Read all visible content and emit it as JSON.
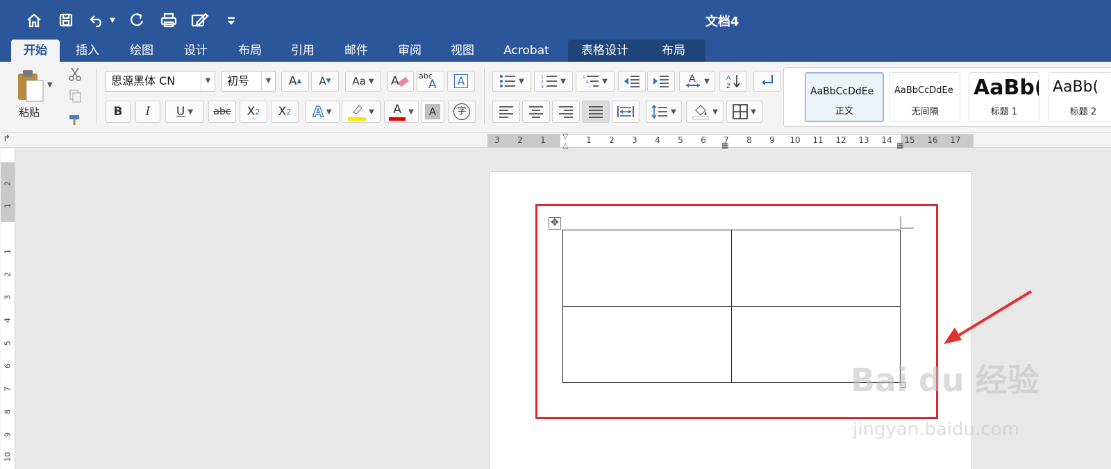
{
  "app": {
    "document_title": "文档4",
    "accent_color": "#2b579a"
  },
  "quick_access": [
    {
      "name": "home-icon"
    },
    {
      "name": "save-icon"
    },
    {
      "name": "undo-icon"
    },
    {
      "name": "redo-icon"
    },
    {
      "name": "print-icon"
    },
    {
      "name": "edit-doc-icon"
    },
    {
      "name": "customize-toolbar-icon"
    }
  ],
  "tabs": [
    {
      "label": "开始",
      "active": true
    },
    {
      "label": "插入"
    },
    {
      "label": "绘图"
    },
    {
      "label": "设计"
    },
    {
      "label": "布局"
    },
    {
      "label": "引用"
    },
    {
      "label": "邮件"
    },
    {
      "label": "审阅"
    },
    {
      "label": "视图"
    },
    {
      "label": "Acrobat"
    },
    {
      "label": "表格设计",
      "contextual": true
    },
    {
      "label": "布局",
      "contextual": true
    }
  ],
  "clipboard": {
    "paste_label": "粘贴"
  },
  "font": {
    "family": "思源黑体 CN",
    "size": "初号",
    "bold": "B",
    "italic": "I",
    "underline": "U",
    "strikethrough": "abc",
    "subscript": "X",
    "subscript_mark": "2",
    "superscript": "X",
    "superscript_mark": "2",
    "grow": "A",
    "shrink": "A",
    "change_case": "Aa",
    "phonetic": "abc",
    "font_color_glyph": "A",
    "shading_glyph": "A",
    "enclose_glyph": "字",
    "highlight_color": "#f5e600",
    "font_color": "#e00000"
  },
  "styles": [
    {
      "sample": "AaBbCcDdEe",
      "name": "正文",
      "selected": true
    },
    {
      "sample": "AaBbCcDdEe",
      "name": "无间隔"
    },
    {
      "sample": "AaBb(",
      "name": "标题 1"
    },
    {
      "sample": "AaBb(",
      "name": "标题 2"
    }
  ],
  "ruler": {
    "left_labels": [
      "3",
      "2",
      "1"
    ],
    "right_labels": [
      "1",
      "2",
      "3",
      "4",
      "5",
      "6",
      "7",
      "8",
      "9",
      "10",
      "11",
      "12",
      "13",
      "14",
      "15",
      "16",
      "17"
    ],
    "vertical_labels": [
      "2",
      "1",
      "1",
      "2",
      "3",
      "4",
      "5",
      "6",
      "7",
      "8",
      "9",
      "10"
    ]
  },
  "document": {
    "table": {
      "rows": 2,
      "cols": 2
    },
    "move_handle_glyph": "✥"
  },
  "annotation": {
    "highlight_color": "#d9282f"
  },
  "watermark": {
    "brand": "Bai du 经验",
    "url": "jingyan.baidu.com"
  }
}
